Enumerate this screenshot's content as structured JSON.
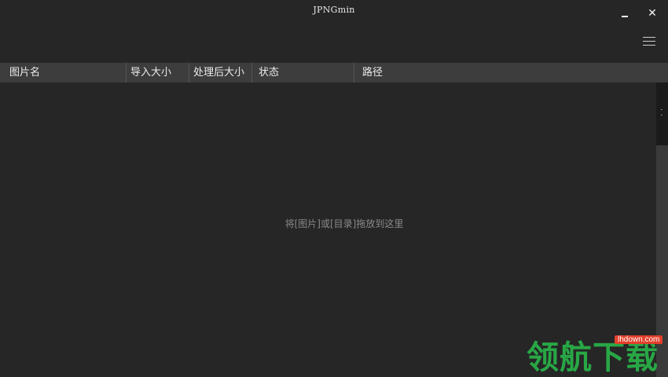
{
  "window": {
    "title": "JPNGmin",
    "minimize_symbol": "‒",
    "close_symbol": "✕"
  },
  "toolbar": {
    "menu_icon": "hamburger-menu-icon"
  },
  "table": {
    "columns": [
      "图片名",
      "导入大小",
      "处理后大小",
      "状态",
      "路径"
    ],
    "rows": []
  },
  "main": {
    "drop_hint": "将[图片]或[目录]拖放到这里"
  },
  "watermark": {
    "site": "lhdown.com",
    "text": "领航下载"
  },
  "colors": {
    "background": "#262626",
    "header_background": "#3d3d3d",
    "watermark_green": "#28a745",
    "watermark_badge": "#e2402b"
  }
}
